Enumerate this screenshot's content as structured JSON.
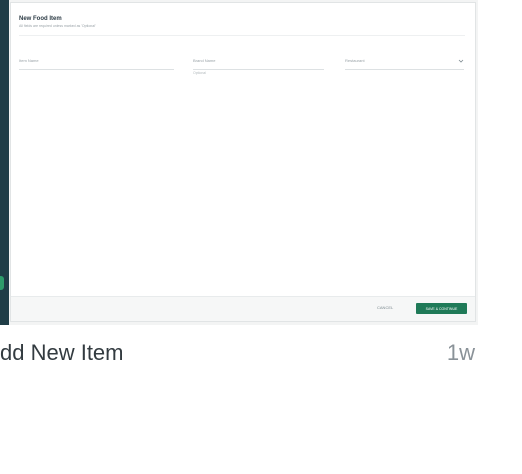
{
  "dialog": {
    "title": "New Food Item",
    "subtitle": "All fields are required unless marked as 'Optional'",
    "fields": [
      {
        "placeholder": "Item Name",
        "hint": ""
      },
      {
        "placeholder": "Brand Name",
        "hint": "Optional"
      },
      {
        "placeholder": "Restaurant",
        "hint": ""
      }
    ],
    "cancel_label": "CANCEL",
    "save_label": "SAVE & CONTINUE"
  },
  "caption": {
    "title": "dd New Item",
    "time": "1w"
  },
  "colors": {
    "sidebar": "#1f3d47",
    "accent": "#2e9c6b",
    "primary_button": "#1f7a58"
  }
}
